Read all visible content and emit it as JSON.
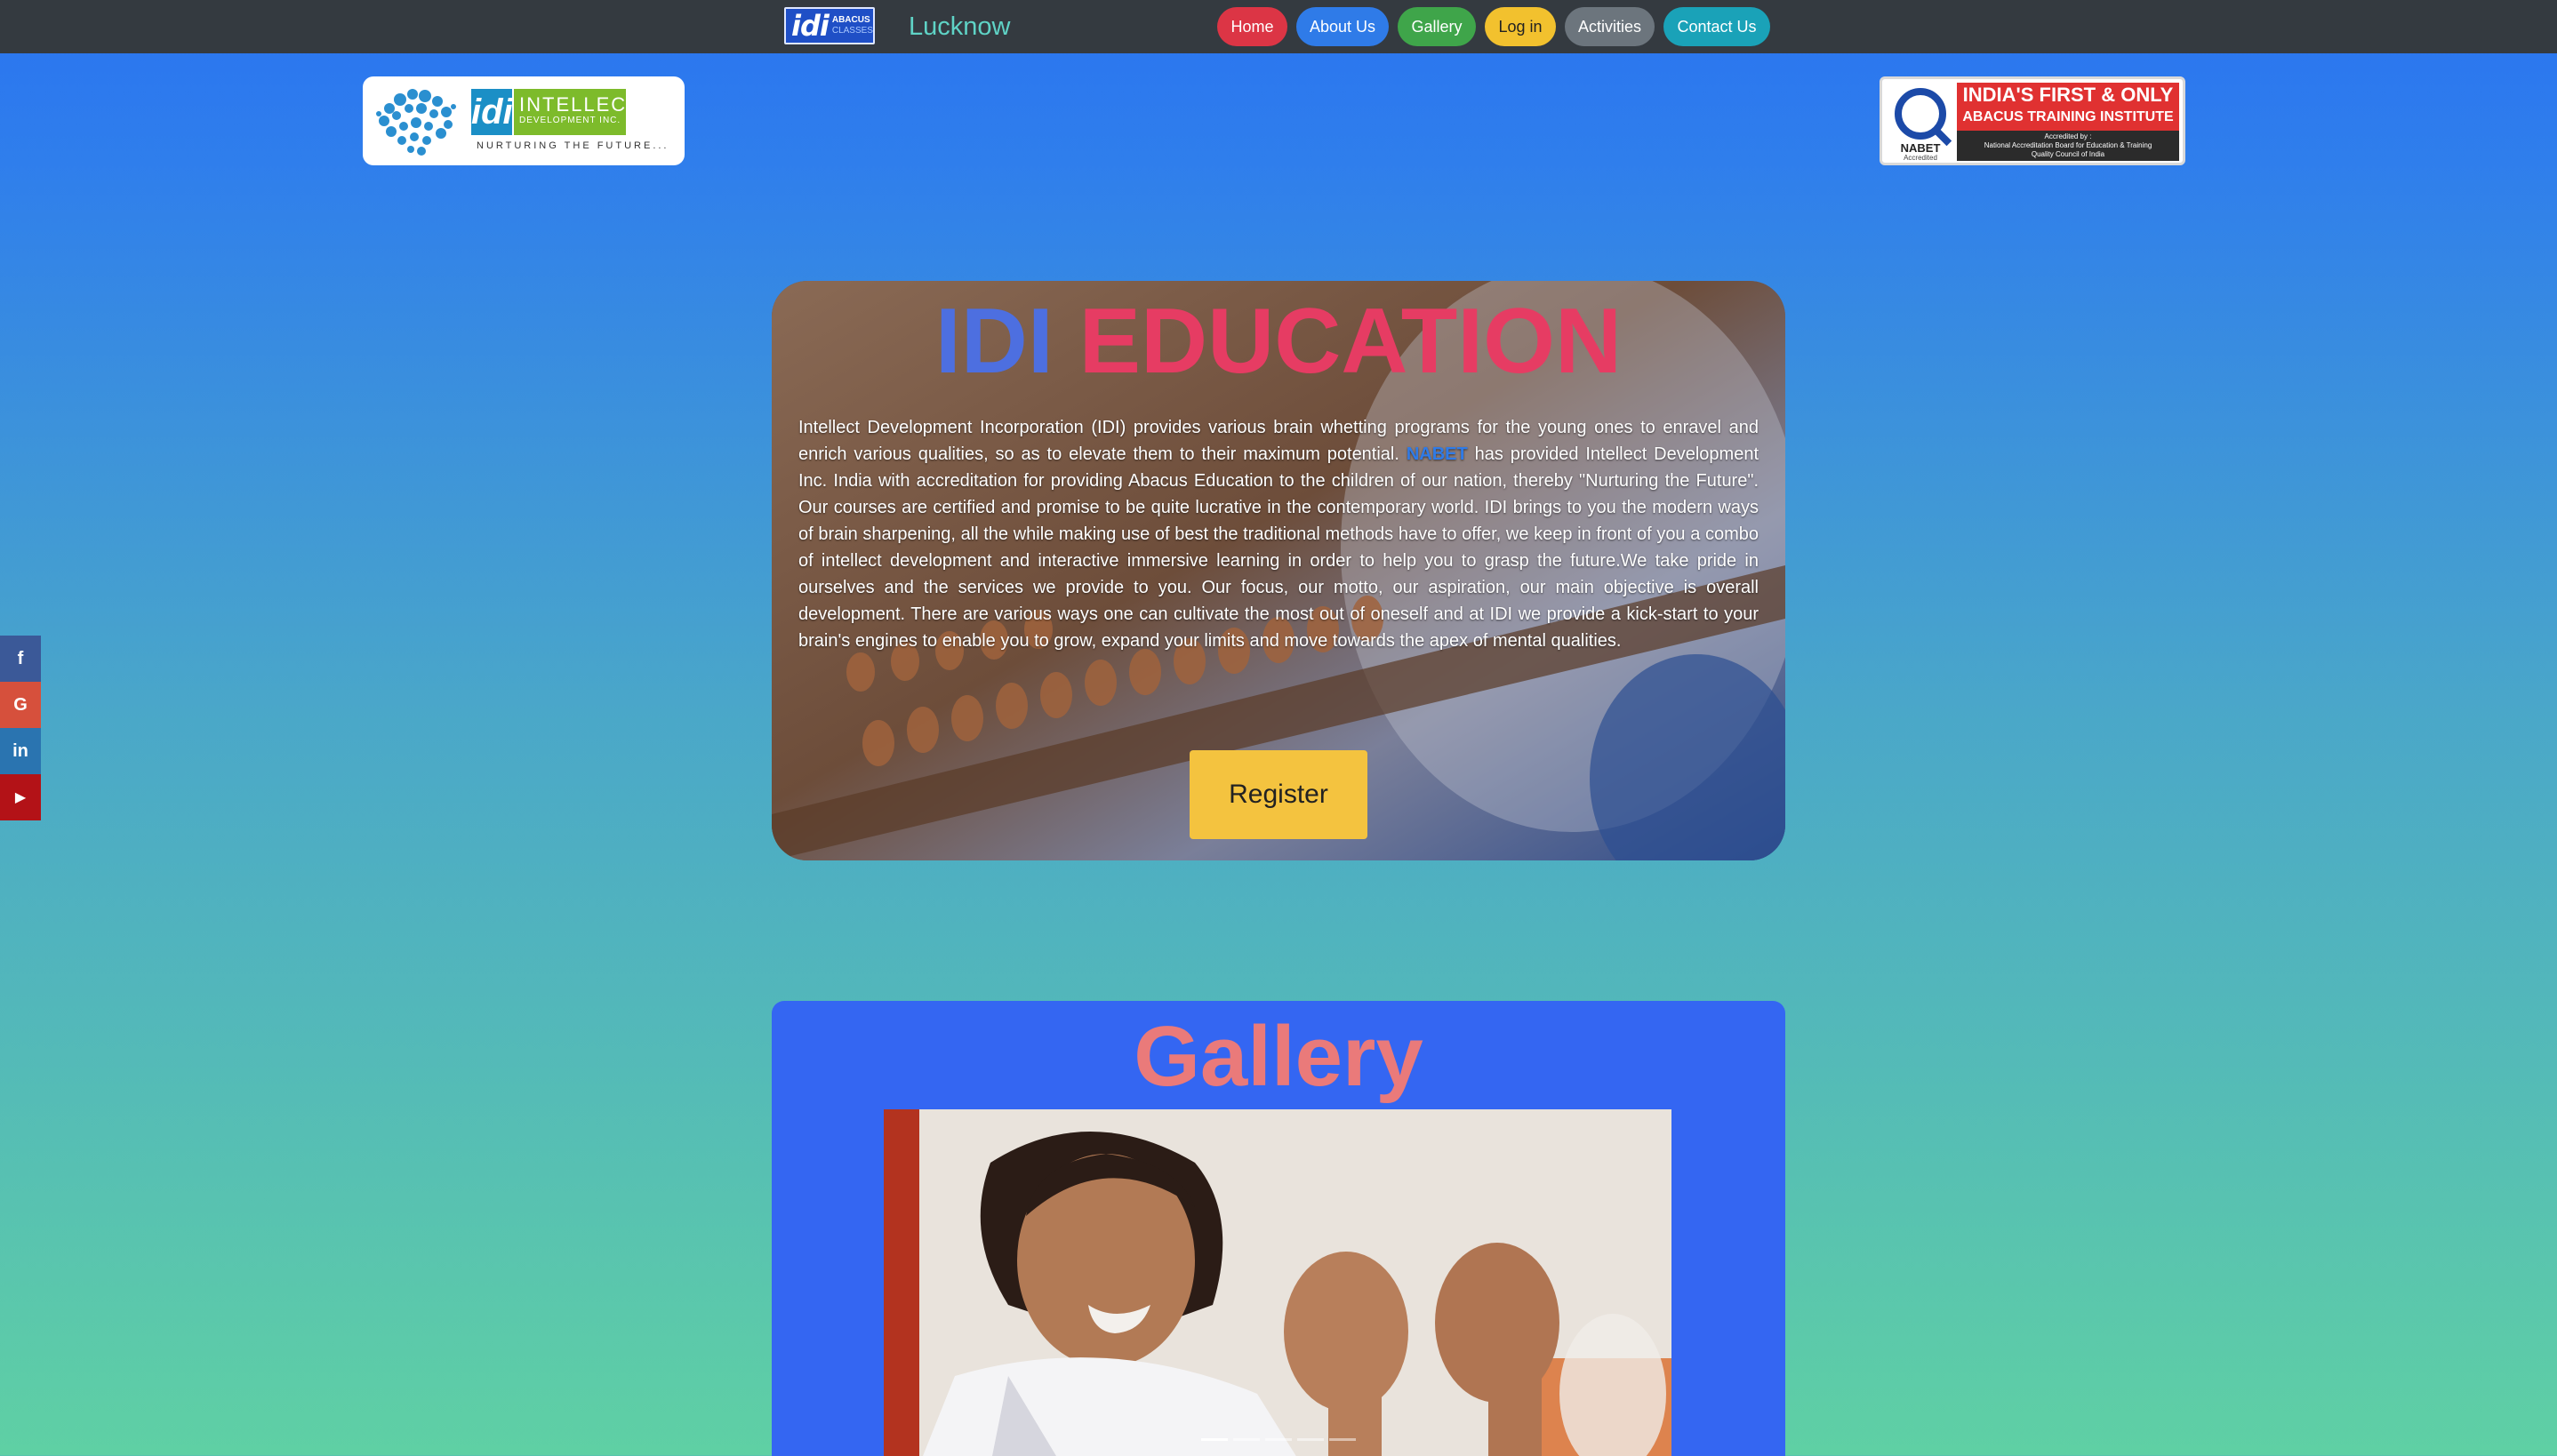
{
  "navbar": {
    "brand_logo": {
      "word": "idi",
      "line1": "ABACUS",
      "line2": "CLASSES"
    },
    "city": "Lucknow",
    "items": [
      {
        "label": "Home",
        "color": "#dc3545"
      },
      {
        "label": "About Us",
        "color": "#2f7be8"
      },
      {
        "label": "Gallery",
        "color": "#3fa54a"
      },
      {
        "label": "Log in",
        "color": "#f2c12e"
      },
      {
        "label": "Activities",
        "color": "#6c757d"
      },
      {
        "label": "Contact Us",
        "color": "#1aa2b8"
      }
    ]
  },
  "header": {
    "idi_logo": {
      "mark": "idi",
      "name": "INTELLECT",
      "sub": "DEVELOPMENT INC.",
      "tagline": "NURTURING THE FUTURE..."
    },
    "nabet_badge": {
      "line1": "INDIA'S FIRST & ONLY",
      "line2": "ABACUS TRAINING INSTITUTE",
      "accredited_by": "Accredited by :",
      "board": "National Accreditation Board for Education & Training",
      "council": "Quality Council of India",
      "seal_label": "NABET",
      "seal_sub": "Accredited"
    }
  },
  "social": [
    {
      "icon": "facebook-icon",
      "glyph": "f"
    },
    {
      "icon": "google-icon",
      "glyph": "G"
    },
    {
      "icon": "linkedin-icon",
      "glyph": "in"
    },
    {
      "icon": "youtube-icon",
      "glyph": "▶"
    }
  ],
  "hero": {
    "title_part1": "IDI",
    "title_part2": "EDUCATION",
    "text_before": "Intellect Development Incorporation (IDI) provides various brain whetting programs for the young ones to enravel and enrich various qualities, so as to elevate them to their maximum potential. ",
    "nabet_link": "NABET",
    "text_after": " has provided Intellect Development Inc. India with accreditation for providing Abacus Education to the children of our nation, thereby \"Nurturing the Future\". Our courses are certified and promise to be quite lucrative in the contemporary world. IDI brings to you the modern ways of brain sharpening, all the while making use of best the traditional methods have to offer, we keep in front of you a combo of intellect development and interactive immersive learning in order to help you to grasp the future.We take pride in ourselves and the services we provide to you. Our focus, our motto, our aspiration, our main objective is overall development. There are various ways one can cultivate the most out of oneself and at IDI we provide a kick-start to your brain's engines to enable you to grow, expand your limits and move towards the apex of mental qualities.",
    "register_label": "Register"
  },
  "gallery": {
    "title": "Gallery",
    "slides_count": 5,
    "active_slide": 1
  },
  "colors": {
    "navbar": "#343a40",
    "title_blue": "#4d6fe0",
    "title_red": "#e63c63",
    "gallery_bg": "#3466f2",
    "gallery_title": "#ea7a7a",
    "register": "#f4c33f"
  }
}
